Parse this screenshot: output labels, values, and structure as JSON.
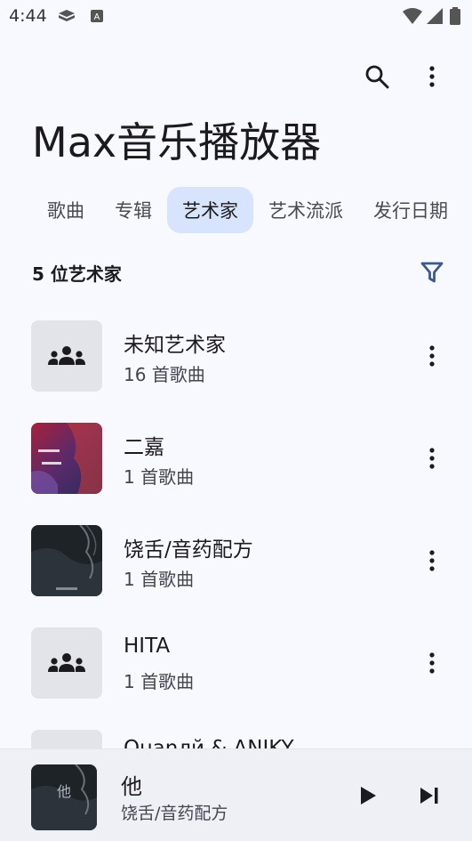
{
  "status_bar": {
    "time": "4:44"
  },
  "app": {
    "title": "Max音乐播放器"
  },
  "tabs": [
    {
      "label": "歌曲",
      "active": false
    },
    {
      "label": "专辑",
      "active": false
    },
    {
      "label": "艺术家",
      "active": true
    },
    {
      "label": "艺术流派",
      "active": false
    },
    {
      "label": "发行日期",
      "active": false
    }
  ],
  "list_header": {
    "count_label": "5 位艺术家"
  },
  "artists": [
    {
      "name": "未知艺术家",
      "songs": "16 首歌曲",
      "art": "placeholder-people-icon"
    },
    {
      "name": "二嘉",
      "songs": "1 首歌曲",
      "art": "album-art-red"
    },
    {
      "name": "饶舌/音药配方",
      "songs": "1 首歌曲",
      "art": "album-art-dark"
    },
    {
      "name": "HITA",
      "songs": "1 首歌曲",
      "art": "placeholder-people-icon"
    },
    {
      "name": "Quanлй & ANIKY",
      "songs": "",
      "art": "placeholder-people-icon"
    }
  ],
  "now_playing": {
    "title": "他",
    "artist": "饶舌/音药配方",
    "art_text": "他"
  },
  "colors": {
    "accent": "#3a5a8c",
    "active_tab_bg": "#d8e4fb",
    "background": "#f8f9fe"
  }
}
